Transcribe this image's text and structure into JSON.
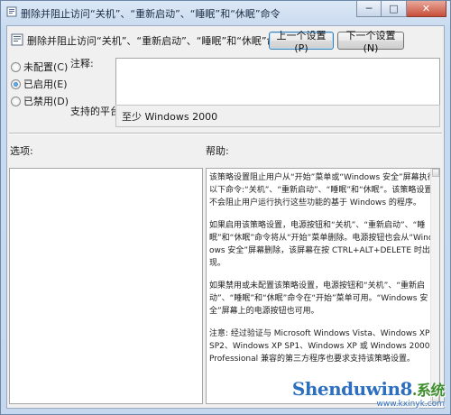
{
  "window": {
    "title": "删除并阻止访问“关机”、“重新启动”、“睡眠”和“休眠”命令",
    "controls": {
      "minimize": "─",
      "maximize": "□",
      "close": "✕"
    }
  },
  "header": {
    "policy_title": "删除并阻止访问“关机”、“重新启动”、“睡眠”和“休眠”命令",
    "prev_button": "上一个设置(P)",
    "next_button": "下一个设置(N)"
  },
  "state": {
    "options": [
      {
        "label": "未配置(C)",
        "selected": false
      },
      {
        "label": "已启用(E)",
        "selected": true
      },
      {
        "label": "已禁用(D)",
        "selected": false
      }
    ]
  },
  "comment": {
    "label": "注释:",
    "value": ""
  },
  "platform": {
    "label": "支持的平台:",
    "value": "至少 Windows 2000"
  },
  "options_pane": {
    "label": "选项:"
  },
  "help_pane": {
    "label": "帮助:",
    "paragraphs": [
      "该策略设置阻止用户从“开始”菜单或“Windows 安全”屏幕执行以下命令:“关机”、“重新启动”、“睡眠”和“休眠”。该策略设置不会阻止用户运行执行这些功能的基于 Windows 的程序。",
      "如果启用该策略设置，电源按钮和“关机”、“重新启动”、“睡眠”和“休眠”命令将从“开始”菜单删除。电源按钮也会从“Windows 安全”屏幕删除，该屏幕在按 CTRL+ALT+DELETE 时出现。",
      "如果禁用或未配置该策略设置，电源按钮和“关机”、“重新启动”、“睡眠”和“休眠”命令在“开始”菜单可用。“Windows 安全”屏幕上的电源按钮也可用。",
      "注意: 经过验证与 Microsoft Windows Vista、Windows XP SP2、Windows XP SP1、Windows XP 或 Windows 2000 Professional 兼容的第三方程序也要求支持该策略设置。"
    ]
  },
  "watermark": {
    "logo": "Shenduwin8",
    "logo_cn": ".系统",
    "url": "www.kxinyk.com"
  }
}
